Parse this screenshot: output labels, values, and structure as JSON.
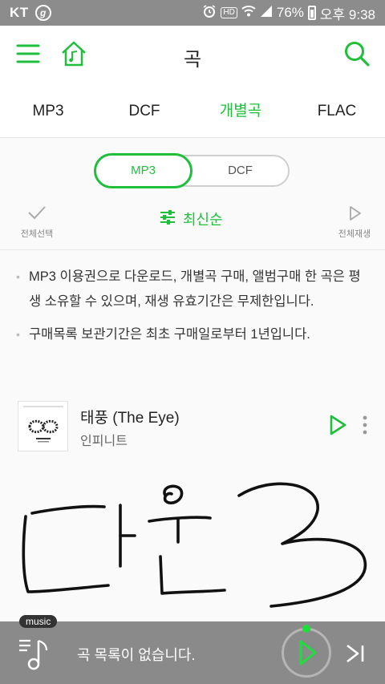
{
  "status_bar": {
    "carrier": "KT",
    "g_icon_letter": "g",
    "battery": "76%",
    "time": "오후 9:38",
    "hd_label": "HD"
  },
  "header": {
    "title": "곡",
    "icons": [
      "menu-icon",
      "home-music-icon",
      "search-icon"
    ]
  },
  "tabs": [
    {
      "label": "MP3",
      "active": false
    },
    {
      "label": "DCF",
      "active": false
    },
    {
      "label": "개별곡",
      "active": true
    },
    {
      "label": "FLAC",
      "active": false
    }
  ],
  "format_toggle": {
    "options": [
      "MP3",
      "DCF"
    ],
    "selected": "MP3"
  },
  "toolbar": {
    "select_all_label": "전체선택",
    "sort_label": "최신순",
    "play_all_label": "전체재생"
  },
  "notices": [
    "MP3 이용권으로 다운로드, 개별곡 구매, 앨범구매 한 곡은 평생 소유할 수 있으며, 재생 유효기간은 무제한입니다.",
    "구매목록 보관기간은 최초 구매일로부터 1년입니다."
  ],
  "songs": [
    {
      "title": "태풍 (The Eye)",
      "artist": "인피니트"
    }
  ],
  "player": {
    "badge": "music",
    "status": "곡 목록이 없습니다."
  },
  "colors": {
    "accent": "#1fbf3c",
    "status_bar": "#8c8c8c",
    "player_bg": "#8a8a8a"
  }
}
